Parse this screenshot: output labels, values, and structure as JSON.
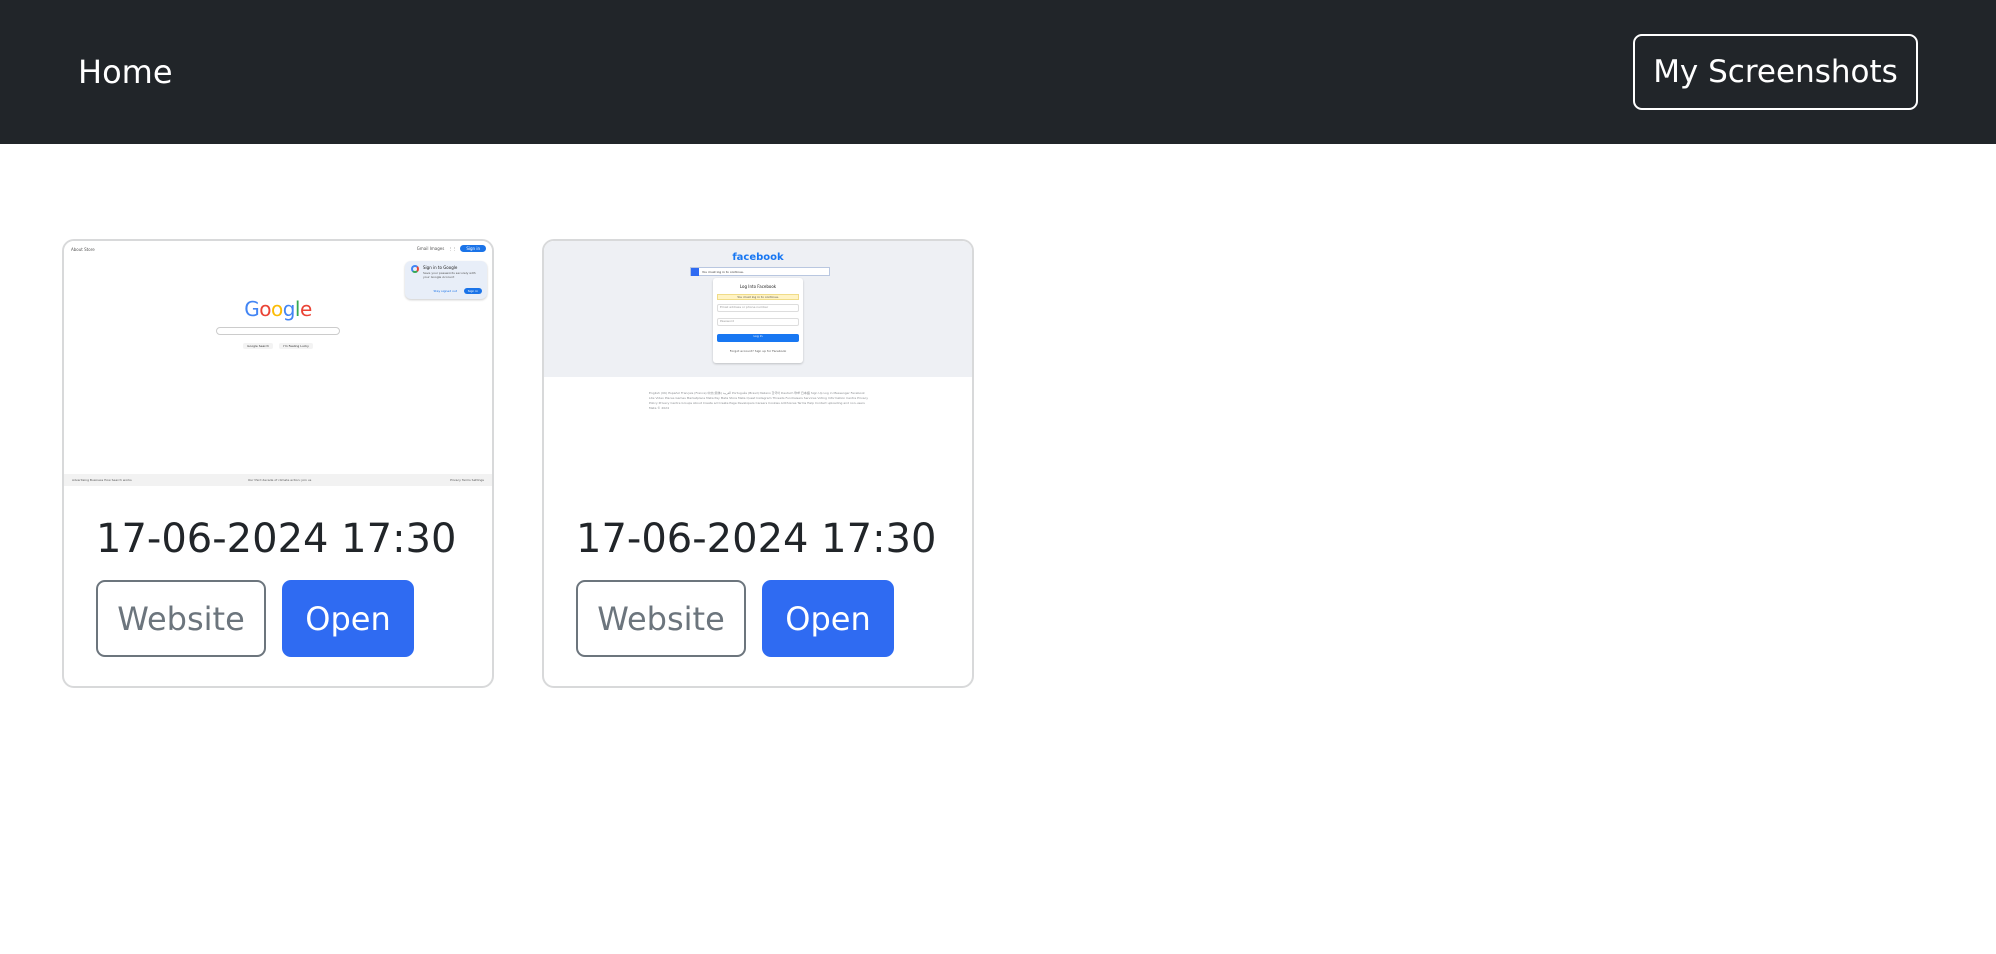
{
  "navbar": {
    "home_label": "Home",
    "my_screenshots_label": "My Screenshots"
  },
  "cards": [
    {
      "date": "17-06-2024 17:30",
      "website_label": "Website",
      "open_label": "Open",
      "thumbnail": {
        "site": "google",
        "top_left": "About  Store",
        "top_right": "Gmail  Images",
        "signin": "Sign in",
        "popup_title": "Sign in to Google",
        "popup_desc": "Save your passwords securely with your Google Account",
        "popup_stay": "Stay signed out",
        "popup_signin": "Sign in",
        "logo": [
          "G",
          "o",
          "o",
          "g",
          "l",
          "e"
        ],
        "btn_search": "Google Search",
        "btn_lucky": "I'm Feeling Lucky",
        "footer_left": "Advertising   Business   How Search works",
        "footer_center": "Our third decade of climate action: join us",
        "footer_right": "Privacy   Terms   Settings"
      }
    },
    {
      "date": "17-06-2024 17:30",
      "website_label": "Website",
      "open_label": "Open",
      "thumbnail": {
        "site": "facebook",
        "logo": "facebook",
        "bar_text": "You must log in to continue.",
        "box_title": "Log Into Facebook",
        "box_warning": "You must log in to continue.",
        "email_placeholder": "Email address or phone number",
        "password_placeholder": "Password",
        "login": "Log In",
        "signup": "Forgot account?  Sign up for Facebook",
        "links": "English (UK)  Español  Français (France)  中文(简体)  العربية  Português (Brasil)  Italiano  한국어  Deutsch  हिन्दी  日本語   Sign Up  Log in  Messenger  Facebook Lite  Video  Places  Games  Marketplace  Meta Pay  Meta Store  Meta Quest  Instagram  Threads  Fundraisers  Services  Voting Information Centre  Privacy Policy  Privacy Centre  Groups  About  Create ad  Create Page  Developers  Careers  Cookies  AdChoices  Terms  Help  Contact uploading and non-users   Meta © 2024"
      }
    }
  ],
  "colors": {
    "navbar_bg": "#212529",
    "primary": "#2f6bf2",
    "secondary": "#6c757d"
  }
}
